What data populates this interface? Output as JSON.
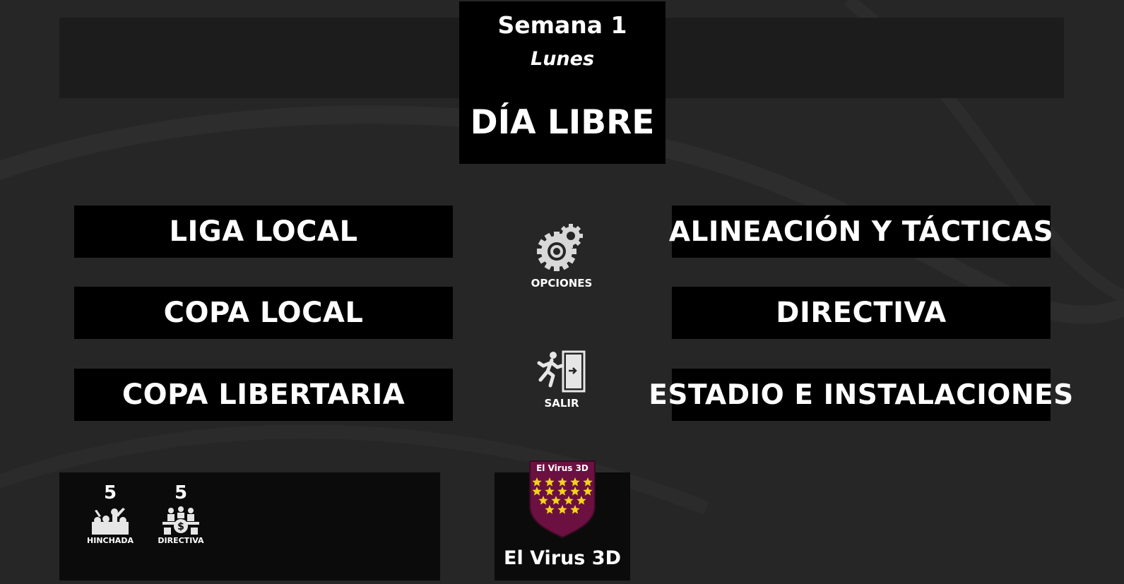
{
  "header": {
    "week": "Semana 1",
    "day": "Lunes",
    "event": "DÍA LIBRE"
  },
  "left_menu": [
    {
      "label": "LIGA LOCAL"
    },
    {
      "label": "COPA LOCAL"
    },
    {
      "label": "COPA LIBERTARIA"
    }
  ],
  "right_menu": [
    {
      "label": "ALINEACIÓN Y TÁCTICAS"
    },
    {
      "label": "DIRECTIVA"
    },
    {
      "label": "ESTADIO E INSTALACIONES"
    }
  ],
  "center": {
    "options": {
      "label": "OPCIONES",
      "icon": "gears-icon"
    },
    "exit": {
      "label": "SALIR",
      "icon": "exit-door-icon"
    }
  },
  "stats": {
    "hinchada": {
      "value": "5",
      "label": "HINCHADA",
      "icon": "fans-icon"
    },
    "directiva": {
      "value": "5",
      "label": "DIRECTIVA",
      "icon": "board-money-icon"
    }
  },
  "team": {
    "name": "El Virus 3D",
    "crest_text": "El Virus 3D",
    "crest_color": "#6b1040",
    "star_color": "#f2d21b",
    "star_count": 17
  },
  "colors": {
    "background": "#262626",
    "panel": "#000000",
    "text": "#ffffff"
  }
}
